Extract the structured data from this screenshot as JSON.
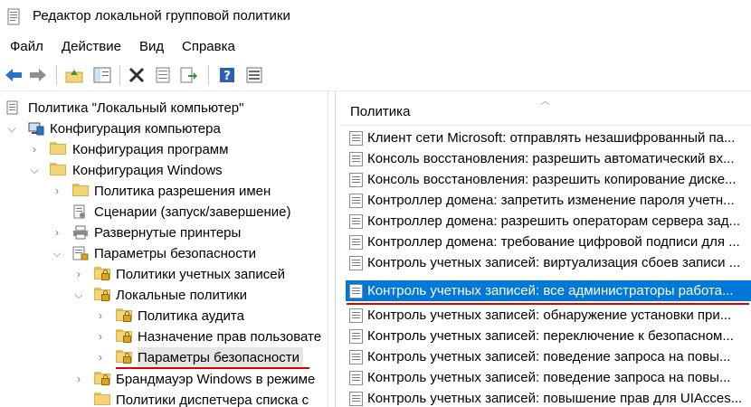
{
  "window": {
    "title": "Редактор локальной групповой политики"
  },
  "menu": [
    "Файл",
    "Действие",
    "Вид",
    "Справка"
  ],
  "toolbar": [
    "back-arrow-icon",
    "forward-arrow-icon",
    "up-folder-icon",
    "show-hide-tree-icon",
    "delete-icon",
    "properties-icon",
    "export-list-icon",
    "help-icon",
    "filter-icon"
  ],
  "tree": [
    {
      "label": "Политика \"Локальный компьютер\"",
      "expander": "",
      "icon": "policy-doc-icon"
    },
    {
      "label": "Конфигурация компьютера",
      "expander": "v",
      "icon": "computer-icon"
    },
    {
      "label": "Конфигурация программ",
      "expander": ">",
      "icon": "folder-icon"
    },
    {
      "label": "Конфигурация Windows",
      "expander": "v",
      "icon": "folder-icon"
    },
    {
      "label": "Политика разрешения имен",
      "expander": ">",
      "icon": "folder-icon"
    },
    {
      "label": "Сценарии (запуск/завершение)",
      "expander": "",
      "icon": "script-icon"
    },
    {
      "label": "Развернутые принтеры",
      "expander": ">",
      "icon": "printer-icon"
    },
    {
      "label": "Параметры безопасности",
      "expander": "v",
      "icon": "security-folder-icon"
    },
    {
      "label": "Политики учетных записей",
      "expander": ">",
      "icon": "locked-folder-icon"
    },
    {
      "label": "Локальные политики",
      "expander": "v",
      "icon": "locked-folder-icon"
    },
    {
      "label": "Политика аудита",
      "expander": ">",
      "icon": "locked-folder-icon"
    },
    {
      "label": "Назначение прав пользовате",
      "expander": ">",
      "icon": "locked-folder-icon"
    },
    {
      "label": "Параметры безопасности",
      "expander": ">",
      "icon": "locked-folder-icon"
    },
    {
      "label": "Брандмауэр Windows в режиме",
      "expander": ">",
      "icon": "locked-folder-icon"
    },
    {
      "label": "Политики диспетчера списка с",
      "expander": "",
      "icon": "folder-icon"
    }
  ],
  "list": {
    "column": "Политика",
    "rows": [
      "Клиент сети Microsoft: отправлять незашифрованный па...",
      "Консоль восстановления: разрешить автоматический вх...",
      "Консоль восстановления: разрешить копирование диске...",
      "Контроллер домена: запретить изменение пароля учетн...",
      "Контроллер домена: разрешить операторам сервера зад...",
      "Контроллер домена: требование цифровой подписи для ...",
      "Контроль учетных записей: виртуализация сбоев записи ...",
      "Контроль учетных записей: все администраторы работа...",
      "Контроль учетных записей: обнаружение установки при...",
      "Контроль учетных записей: переключение к безопасном...",
      "Контроль учетных записей: поведение запроса на повы...",
      "Контроль учетных записей: поведение запроса на повы...",
      "Контроль учетных записей: повышение прав для UIAcces..."
    ],
    "selected_index": 7
  },
  "colors": {
    "selection": "#0078d7",
    "annotation_underline": "#d80000"
  }
}
